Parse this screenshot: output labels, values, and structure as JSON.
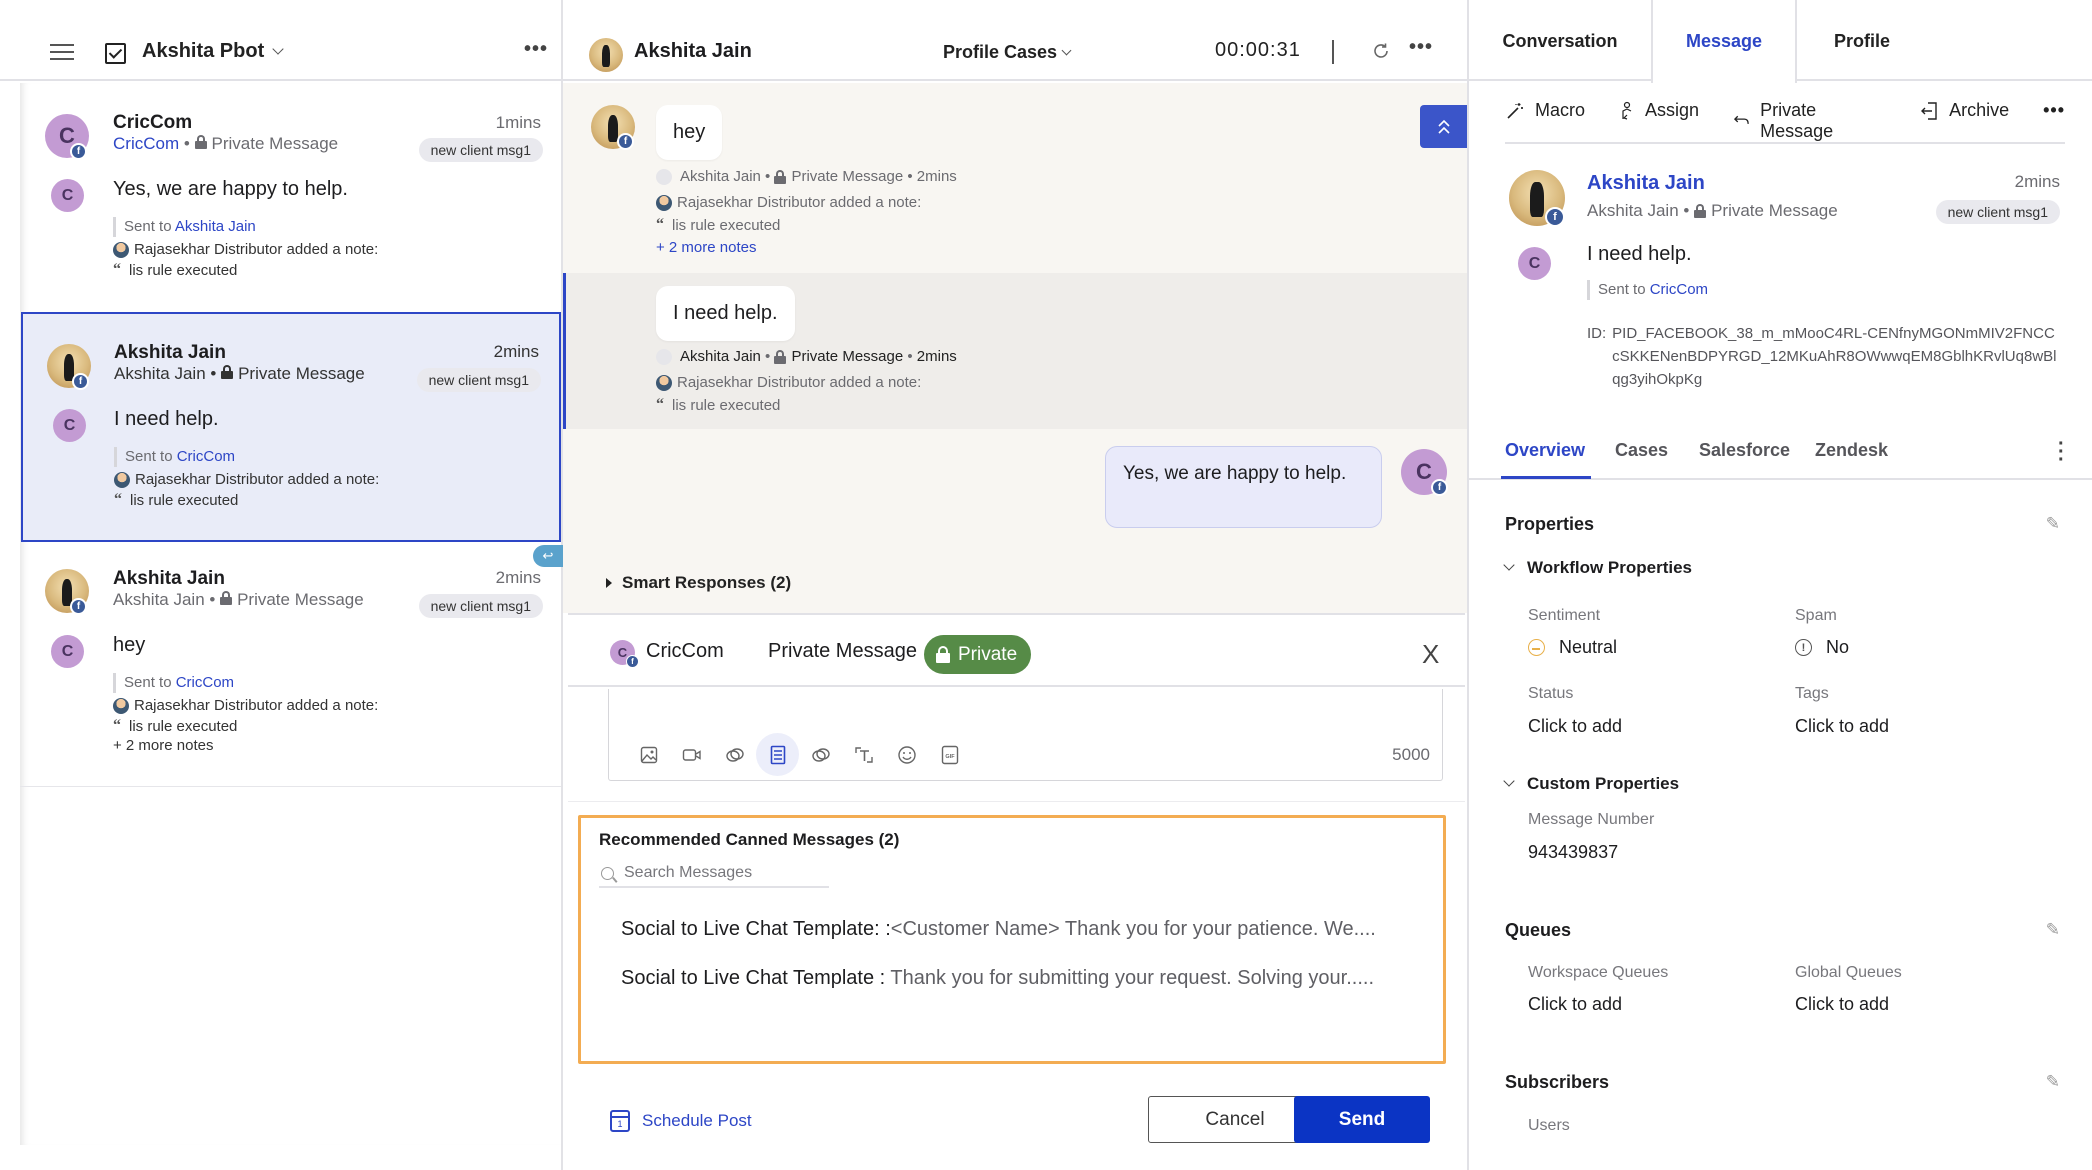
{
  "left_header": {
    "workspace": "Akshita Pbot",
    "more": "•••"
  },
  "conversations": [
    {
      "name": "CricCom",
      "source": "CricCom",
      "channel": "Private Message",
      "time": "1mins",
      "tag": "new client msg1",
      "avatar_initial": "C",
      "message": "Yes, we are happy to help.",
      "sent_to_label": "Sent to",
      "sent_to": "Akshita Jain",
      "note_author": "Rajasekhar Distributor added a note:",
      "note_text": "lis rule executed",
      "more_notes": ""
    },
    {
      "name": "Akshita Jain",
      "source": "Akshita Jain",
      "channel": "Private Message",
      "time": "2mins",
      "tag": "new client msg1",
      "avatar_initial": "C",
      "message": "I need help.",
      "sent_to_label": "Sent to",
      "sent_to": "CricCom",
      "note_author": "Rajasekhar Distributor added a note:",
      "note_text": "lis rule executed",
      "more_notes": "",
      "selected": true
    },
    {
      "name": "Akshita Jain",
      "source": "Akshita Jain",
      "channel": "Private Message",
      "time": "2mins",
      "tag": "new client msg1",
      "avatar_initial": "C",
      "message": "hey",
      "sent_to_label": "Sent to",
      "sent_to": "CricCom",
      "note_author": "Rajasekhar Distributor added a note:",
      "note_text": "lis rule executed",
      "more_notes": "+ 2 more notes"
    }
  ],
  "center_header": {
    "contact": "Akshita Jain",
    "view": "Profile Cases",
    "timer": "00:00:31",
    "more": "•••"
  },
  "chat": {
    "messages": [
      {
        "text": "hey",
        "author": "Akshita Jain",
        "channel": "Private Message",
        "time": "2mins",
        "note_author": "Rajasekhar Distributor added a note:",
        "note_text": "lis rule executed",
        "more_notes": "+ 2 more notes"
      },
      {
        "text": "I need help.",
        "author": "Akshita Jain",
        "channel": "Private Message",
        "time": "2mins",
        "note_author": "Rajasekhar Distributor added a note:",
        "note_text": "lis rule executed"
      }
    ],
    "outgoing": {
      "text": "Yes, we are happy to help.",
      "avatar_initial": "C"
    },
    "smart_responses": "Smart Responses (2)"
  },
  "composer": {
    "account": "CricCom",
    "account_initial": "C",
    "type": "Private Message",
    "privacy": "Private",
    "close": "X",
    "char_count": "5000",
    "toolbar": [
      {
        "icon": "image-icon",
        "glyph": "🖼"
      },
      {
        "icon": "video-icon",
        "glyph": "▭"
      },
      {
        "icon": "link-icon",
        "glyph": "⊘"
      },
      {
        "icon": "canned-message-icon",
        "glyph": "☰",
        "active": true
      },
      {
        "icon": "link-alt-icon",
        "glyph": "⊘"
      },
      {
        "icon": "text-format-icon",
        "glyph": "T"
      },
      {
        "icon": "emoji-icon",
        "glyph": "☺"
      },
      {
        "icon": "gif-icon",
        "glyph": "GIF"
      }
    ],
    "canned": {
      "title": "Recommended Canned Messages (2)",
      "search_placeholder": "Search Messages",
      "items": [
        {
          "title": "Social to Live Chat Template: :",
          "body": "<Customer Name> Thank you for your patience. We...."
        },
        {
          "title": "Social to Live Chat Template : ",
          "body": "Thank you for submitting your request. Solving your....."
        }
      ]
    },
    "schedule_label": "Schedule Post",
    "schedule_day": "1",
    "cancel_label": "Cancel",
    "send_label": "Send"
  },
  "right_panel": {
    "tabs": [
      "Conversation",
      "Message",
      "Profile"
    ],
    "active_tab": "Message",
    "actions": [
      {
        "icon": "magic-wand-icon",
        "glyph": "✨",
        "label": "Macro"
      },
      {
        "icon": "assign-icon",
        "glyph": "♙",
        "label": "Assign"
      },
      {
        "icon": "reply-icon",
        "glyph": "↩",
        "label": "Private Message"
      },
      {
        "icon": "archive-icon",
        "glyph": "⇤",
        "label": "Archive"
      }
    ],
    "more": "•••",
    "message_card": {
      "name": "Akshita Jain",
      "time": "2mins",
      "source": "Akshita Jain",
      "channel": "Private Message",
      "tag": "new client msg1",
      "avatar_initial": "C",
      "text": "I need help.",
      "sent_to_label": "Sent to",
      "sent_to": "CricCom",
      "id_label": "ID:",
      "id_value": "PID_FACEBOOK_38_m_mMooC4RL-CENfnyMGONmMIV2FNCCcSKKENenBDPYRGD_12MKuAhR8OWwwqEM8GblhKRvlUq8wBlqg3yihOkpKg"
    },
    "subtabs": [
      "Overview",
      "Cases",
      "Salesforce",
      "Zendesk"
    ],
    "active_subtab": "Overview",
    "properties": {
      "title": "Properties",
      "workflow_title": "Workflow Properties",
      "sentiment_label": "Sentiment",
      "sentiment_value": "Neutral",
      "spam_label": "Spam",
      "spam_value": "No",
      "status_label": "Status",
      "status_value": "Click to add",
      "tags_label": "Tags",
      "tags_value": "Click to add",
      "custom_title": "Custom Properties",
      "message_number_label": "Message Number",
      "message_number_value": "943439837"
    },
    "queues": {
      "title": "Queues",
      "workspace_label": "Workspace Queues",
      "workspace_value": "Click to add",
      "global_label": "Global Queues",
      "global_value": "Click to add"
    },
    "subscribers": {
      "title": "Subscribers",
      "users_label": "Users"
    }
  },
  "colors": {
    "accent": "#2d46c6",
    "send_button": "#0b34c4",
    "private_pill": "#568b47",
    "canned_highlight": "#f3ac52",
    "selected_card_bg": "#e9ecf8",
    "avatar_purple": "#c39bd3"
  }
}
